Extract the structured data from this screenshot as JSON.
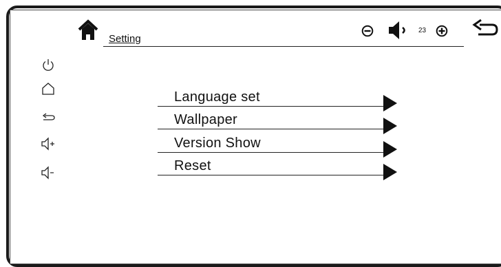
{
  "header": {
    "title": "Setting"
  },
  "volume": {
    "level": "23"
  },
  "menu": {
    "items": [
      {
        "label": "Language set"
      },
      {
        "label": "Wallpaper"
      },
      {
        "label": "Version Show"
      },
      {
        "label": "Reset"
      }
    ]
  },
  "icons": {
    "home": "home-icon",
    "volume_down": "minus-circle-icon",
    "speaker": "speaker-icon",
    "volume_up": "plus-circle-icon",
    "back": "back-arrow-icon",
    "sidebar": [
      "power-icon",
      "home-outline-icon",
      "back-arrow-icon",
      "volume-up-icon",
      "volume-down-icon"
    ]
  }
}
